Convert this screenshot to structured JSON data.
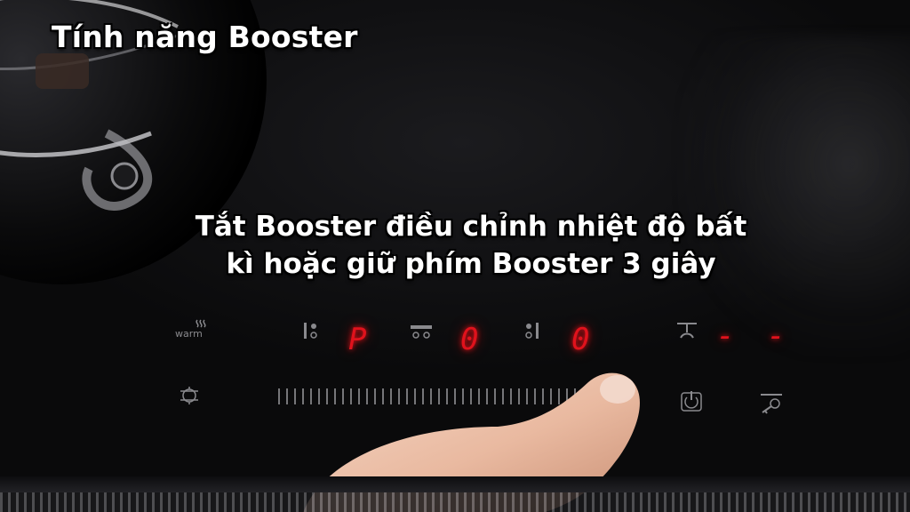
{
  "captions": {
    "title": "Tính năng Booster",
    "line1": "Tắt Booster điều chỉnh nhiệt độ bất",
    "line2": "kì hoặc giữ phím Booster 3 giây"
  },
  "panel": {
    "warm_label": "warm",
    "display_left": "P",
    "display_mid": "0",
    "display_right": "0",
    "timer_display": "- -",
    "icons": [
      "warm-icon",
      "zone-select-icon",
      "dual-zone-icon",
      "zone-select-icon-2",
      "timer-icon",
      "bridge-icon",
      "slider",
      "power-icon",
      "lock-icon"
    ]
  },
  "colors": {
    "segment_red": "#e0121c",
    "panel_icon": "#8a8a8e",
    "caption": "#ffffff"
  }
}
